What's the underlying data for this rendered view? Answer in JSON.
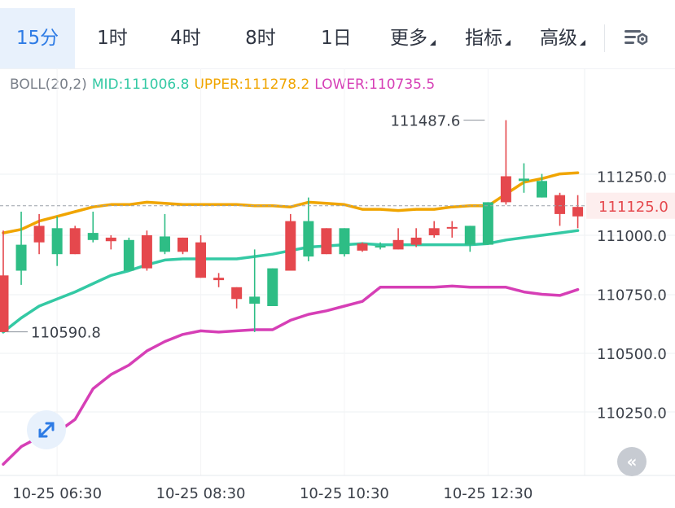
{
  "tabs": [
    {
      "label": "15分",
      "active": true
    },
    {
      "label": "1时"
    },
    {
      "label": "4时"
    },
    {
      "label": "8时"
    },
    {
      "label": "1日"
    },
    {
      "label": "更多",
      "dropdown": true
    },
    {
      "label": "指标",
      "dropdown": true
    },
    {
      "label": "高级",
      "dropdown": true
    }
  ],
  "indicator": {
    "name": "BOLL(20,2)",
    "mid": "MID:111006.8",
    "upper": "UPPER:111278.2",
    "lower": "LOWER:110735.5"
  },
  "colors": {
    "up": "#2ebd85",
    "down": "#e5484d",
    "mid": "#34c9a4",
    "upper": "#f0a500",
    "lower": "#d63fb6",
    "active_tab": "#2d7be5",
    "axis_text": "#3a3f48"
  },
  "icons": {
    "settings": "chart-settings-icon",
    "expand": "expand-arrows-icon",
    "collapse": "collapse-chevron-icon"
  },
  "collapse_glyph": "«",
  "chart_data": {
    "type": "candlestick",
    "y_ticks": [
      "111250.0",
      "111000.0",
      "110750.0",
      "110500.0",
      "110250.0"
    ],
    "y_tick_values": [
      111250,
      111000,
      110750,
      110500,
      110250
    ],
    "ylim": [
      110000,
      111550
    ],
    "x_ticks": [
      {
        "label": "10-25 06:30",
        "index": 3
      },
      {
        "label": "10-25 08:30",
        "index": 11
      },
      {
        "label": "10-25 10:30",
        "index": 19
      },
      {
        "label": "10-25 12:30",
        "index": 27
      }
    ],
    "current_price": 111125.0,
    "current_price_label": "111125.0",
    "max_label": "111487.6",
    "max_index": 27,
    "max_value": 111487.6,
    "min_label": "110590.8",
    "min_index": 0,
    "min_value": 110590.8,
    "candles": [
      {
        "o": 110830,
        "h": 111020,
        "l": 110590,
        "c": 110590
      },
      {
        "o": 110850,
        "h": 111100,
        "l": 110790,
        "c": 110960
      },
      {
        "o": 111040,
        "h": 111090,
        "l": 110920,
        "c": 110970
      },
      {
        "o": 110920,
        "h": 111080,
        "l": 110870,
        "c": 111030
      },
      {
        "o": 111030,
        "h": 111040,
        "l": 110920,
        "c": 110920
      },
      {
        "o": 110980,
        "h": 111100,
        "l": 110970,
        "c": 111010
      },
      {
        "o": 110990,
        "h": 111000,
        "l": 110940,
        "c": 110975
      },
      {
        "o": 110850,
        "h": 110990,
        "l": 110850,
        "c": 110980
      },
      {
        "o": 111000,
        "h": 111020,
        "l": 110850,
        "c": 110860
      },
      {
        "o": 110930,
        "h": 111090,
        "l": 110920,
        "c": 110995
      },
      {
        "o": 110990,
        "h": 110990,
        "l": 110920,
        "c": 110930
      },
      {
        "o": 110970,
        "h": 111000,
        "l": 110820,
        "c": 110820
      },
      {
        "o": 110820,
        "h": 110840,
        "l": 110780,
        "c": 110810
      },
      {
        "o": 110780,
        "h": 110780,
        "l": 110690,
        "c": 110730
      },
      {
        "o": 110710,
        "h": 110940,
        "l": 110590,
        "c": 110740
      },
      {
        "o": 110700,
        "h": 110860,
        "l": 110700,
        "c": 110860
      },
      {
        "o": 111060,
        "h": 111090,
        "l": 110850,
        "c": 110850
      },
      {
        "o": 110910,
        "h": 111160,
        "l": 110890,
        "c": 111060
      },
      {
        "o": 111030,
        "h": 111030,
        "l": 110920,
        "c": 110920
      },
      {
        "o": 110920,
        "h": 111030,
        "l": 110910,
        "c": 111030
      },
      {
        "o": 110965,
        "h": 110970,
        "l": 110930,
        "c": 110935
      },
      {
        "o": 110950,
        "h": 110970,
        "l": 110940,
        "c": 110955
      },
      {
        "o": 110980,
        "h": 111030,
        "l": 110940,
        "c": 110940
      },
      {
        "o": 110990,
        "h": 111030,
        "l": 110950,
        "c": 110960
      },
      {
        "o": 111030,
        "h": 111060,
        "l": 110990,
        "c": 111000
      },
      {
        "o": 111035,
        "h": 111060,
        "l": 110990,
        "c": 111030
      },
      {
        "o": 110960,
        "h": 111040,
        "l": 110930,
        "c": 111040
      },
      {
        "o": 110960,
        "h": 111140,
        "l": 110960,
        "c": 111140
      },
      {
        "o": 111250,
        "h": 111487.6,
        "l": 111130,
        "c": 111140
      },
      {
        "o": 111230,
        "h": 111305,
        "l": 111180,
        "c": 111240
      },
      {
        "o": 111160,
        "h": 111260,
        "l": 111160,
        "c": 111230
      },
      {
        "o": 111170,
        "h": 111180,
        "l": 111040,
        "c": 111090
      },
      {
        "o": 111120,
        "h": 111170,
        "l": 111030,
        "c": 111080
      }
    ],
    "series": [
      {
        "key": "upper",
        "values": [
          111010,
          111025,
          111060,
          111080,
          111100,
          111120,
          111130,
          111130,
          111140,
          111135,
          111130,
          111130,
          111130,
          111130,
          111125,
          111125,
          111120,
          111140,
          111135,
          111130,
          111110,
          111110,
          111105,
          111110,
          111110,
          111120,
          111125,
          111125,
          111175,
          111225,
          111240,
          111260,
          111265
        ]
      },
      {
        "key": "mid",
        "values": [
          110590,
          110650,
          110700,
          110730,
          110760,
          110795,
          110830,
          110850,
          110875,
          110895,
          110900,
          110900,
          110900,
          110900,
          110910,
          110920,
          110935,
          110950,
          110955,
          110960,
          110965,
          110960,
          110960,
          110960,
          110960,
          110960,
          110960,
          110965,
          110980,
          110990,
          111000,
          111010,
          111020
        ]
      },
      {
        "key": "lower",
        "values": [
          110030,
          110105,
          110145,
          110165,
          110220,
          110350,
          110410,
          110450,
          110510,
          110550,
          110580,
          110595,
          110590,
          110595,
          110600,
          110600,
          110640,
          110665,
          110680,
          110700,
          110720,
          110780,
          110780,
          110780,
          110780,
          110785,
          110780,
          110780,
          110780,
          110760,
          110750,
          110745,
          110770
        ]
      }
    ]
  }
}
